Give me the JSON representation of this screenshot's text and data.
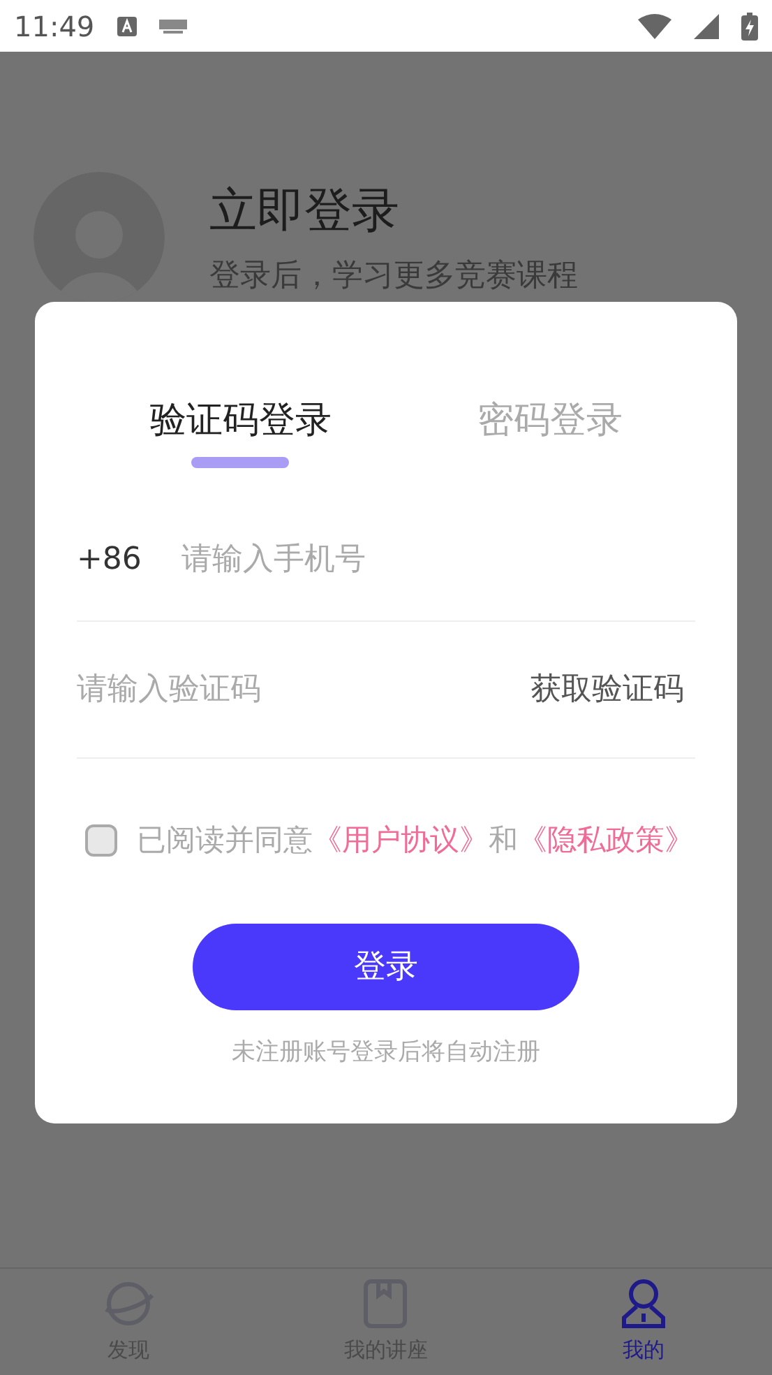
{
  "status_bar": {
    "time": "11:49"
  },
  "profile": {
    "title": "立即登录",
    "subtitle": "登录后，学习更多竞赛课程"
  },
  "dialog": {
    "tabs": [
      {
        "label": "验证码登录",
        "selected": true
      },
      {
        "label": "密码登录",
        "selected": false
      }
    ],
    "phone": {
      "prefix": "+86",
      "placeholder": "请输入手机号"
    },
    "code": {
      "placeholder": "请输入验证码",
      "action": "获取验证码"
    },
    "agreement": {
      "checked": false,
      "parts": [
        {
          "kind": "plain",
          "text": "已阅读并同意"
        },
        {
          "kind": "link",
          "text": "《用户协议》"
        },
        {
          "kind": "plain",
          "text": "和"
        },
        {
          "kind": "link",
          "text": "《隐私政策》"
        }
      ]
    },
    "login_button": "登录",
    "note": "未注册账号登录后将自动注册"
  },
  "bottom_nav": [
    {
      "label": "发现",
      "kind": "planet",
      "selected": false
    },
    {
      "label": "我的讲座",
      "kind": "book",
      "selected": false
    },
    {
      "label": "我的",
      "kind": "person",
      "selected": true
    }
  ]
}
